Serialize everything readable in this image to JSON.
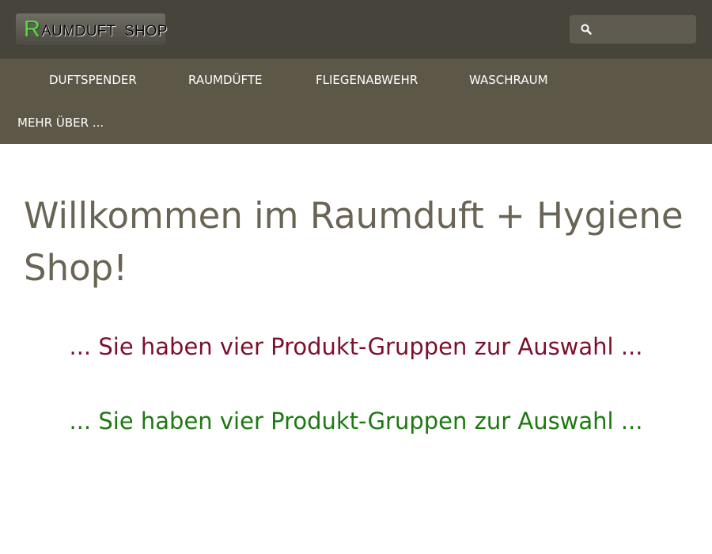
{
  "header": {
    "logo": {
      "initial": "R",
      "rest": "AUMDUFT  SHOP"
    },
    "search": {
      "value": "",
      "placeholder": ""
    }
  },
  "nav": {
    "items": [
      {
        "label": "DUFTSPENDER"
      },
      {
        "label": "RAUMDÜFTE"
      },
      {
        "label": "FLIEGENABWEHR"
      },
      {
        "label": "WASCHRAUM"
      },
      {
        "label": "MEHR ÜBER ..."
      }
    ]
  },
  "main": {
    "title": "Willkommen im Raumduft + Hygiene Shop!",
    "tagline_1": "... Sie haben vier Produkt-Gruppen zur Auswahl ...",
    "tagline_2": "... Sie haben vier Produkt-Gruppen zur Auswahl ..."
  },
  "colors": {
    "header_bg": "#47443b",
    "nav_bg": "#5d5748",
    "title": "#6a6454",
    "tagline_1": "#7d0f2b",
    "tagline_2": "#1c7a10",
    "logo_initial": "#5fd44b"
  }
}
